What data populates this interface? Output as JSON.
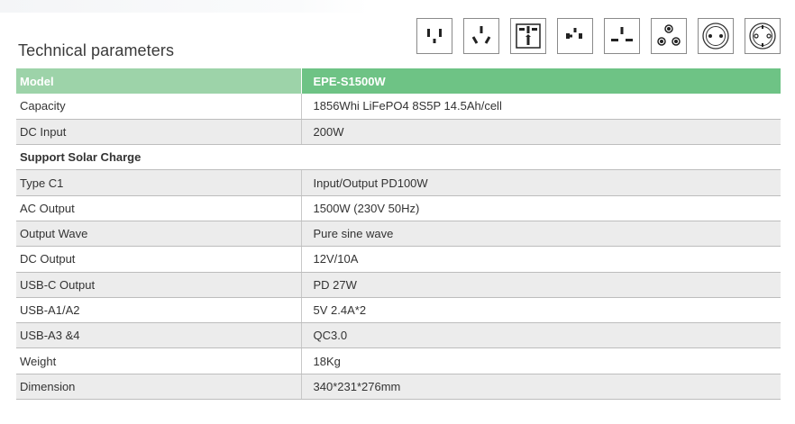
{
  "page": {
    "title": "Technical parameters"
  },
  "plug_icons": [
    "us-plug-icon",
    "au-plug-icon",
    "universal-plug-icon",
    "universal-socket-icon",
    "uk-plug-icon",
    "za-plug-icon",
    "eu-schuko-plug-icon",
    "eu-plug-icon"
  ],
  "colors": {
    "header_left": "#9dd3a9",
    "header_right": "#6ec385",
    "row_alt": "#ececec"
  },
  "table": {
    "header": {
      "label": "Model",
      "value": "EPE-S1500W"
    },
    "rows": [
      {
        "label": "Capacity",
        "value": "1856Whi LiFePO4 8S5P 14.5Ah/cell"
      },
      {
        "label": "DC Input",
        "value": "200W"
      },
      {
        "label": "Support Solar Charge",
        "value": ""
      },
      {
        "label": "Type C1",
        "value": "Input/Output PD100W"
      },
      {
        "label": "AC Output",
        "value": "1500W (230V 50Hz)"
      },
      {
        "label": "Output Wave",
        "value": "Pure sine wave"
      },
      {
        "label": "DC Output",
        "value": "12V/10A"
      },
      {
        "label": "USB-C Output",
        "value": "PD 27W"
      },
      {
        "label": "USB-A1/A2",
        "value": "5V 2.4A*2"
      },
      {
        "label": "USB-A3 &4",
        "value": "QC3.0"
      },
      {
        "label": "Weight",
        "value": "18Kg"
      },
      {
        "label": "Dimension",
        "value": "340*231*276mm"
      }
    ]
  }
}
